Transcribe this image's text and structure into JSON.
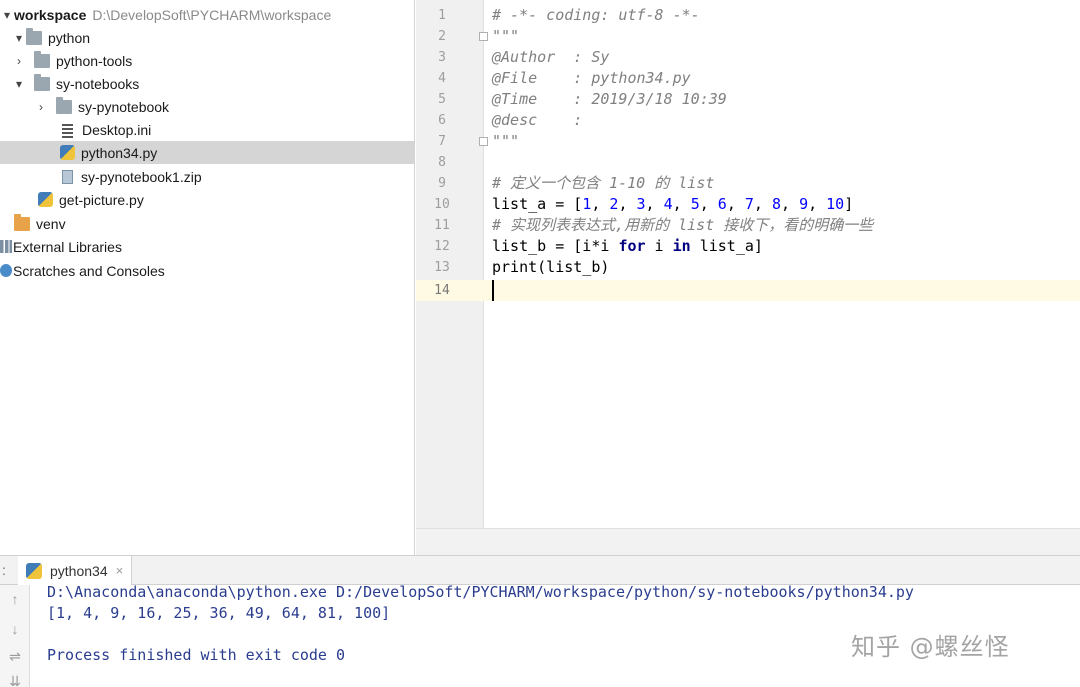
{
  "project_tree": {
    "root": {
      "name": "workspace",
      "path": "D:\\DevelopSoft\\PYCHARM\\workspace"
    },
    "items": [
      {
        "label": "python"
      },
      {
        "label": "python-tools"
      },
      {
        "label": "sy-notebooks"
      },
      {
        "label": "sy-pynotebook"
      },
      {
        "label": "Desktop.ini"
      },
      {
        "label": "python34.py"
      },
      {
        "label": "sy-pynotebook1.zip"
      },
      {
        "label": "get-picture.py"
      },
      {
        "label": "venv"
      },
      {
        "label": "External Libraries"
      },
      {
        "label": "Scratches and Consoles"
      }
    ]
  },
  "editor": {
    "line_numbers": [
      "1",
      "2",
      "3",
      "4",
      "5",
      "6",
      "7",
      "8",
      "9",
      "10",
      "11",
      "12",
      "13",
      "14"
    ],
    "lines": [
      "# -*- coding: utf-8 -*-",
      "\"\"\"",
      "@Author  : Sy",
      "@File    : python34.py",
      "@Time    : 2019/3/18 10:39",
      "@desc    :",
      "\"\"\"",
      "",
      "# 定义一个包含 1-10 的 list",
      "",
      "# 实现列表表达式,用新的 list 接收下，看的明确一些",
      "",
      "print(list_b)",
      ""
    ],
    "tokens": {
      "l10": {
        "name": "list_a = [",
        "n1": "1",
        "n2": "2",
        "n3": "3",
        "n4": "4",
        "n5": "5",
        "n6": "6",
        "n7": "7",
        "n8": "8",
        "n9": "9",
        "n10": "10",
        "sep": ", ",
        "close": "]"
      },
      "l12": {
        "a": "list_b = [i*i ",
        "for": "for",
        "b": " i ",
        "in": "in",
        "c": " list_a]"
      }
    }
  },
  "run": {
    "tab_label": "python34",
    "close_glyph": "×",
    "colon": ":",
    "console_lines": [
      "D:\\Anaconda\\anaconda\\python.exe D:/DevelopSoft/PYCHARM/workspace/python/sy-notebooks/python34.py",
      "[1, 4, 9, 16, 25, 36, 49, 64, 81, 100]",
      "",
      "Process finished with exit code 0"
    ],
    "side_buttons": {
      "up": "↑",
      "down": "↓",
      "wrap": "⇌",
      "scroll": "⇊"
    }
  },
  "watermark": "知乎 @螺丝怪",
  "colors": {
    "selection": "#d5d5d5",
    "current_line": "#fffae3",
    "keyword": "#000080",
    "number": "#0000ff",
    "comment": "#808080",
    "console_text": "#2a3d8f"
  }
}
